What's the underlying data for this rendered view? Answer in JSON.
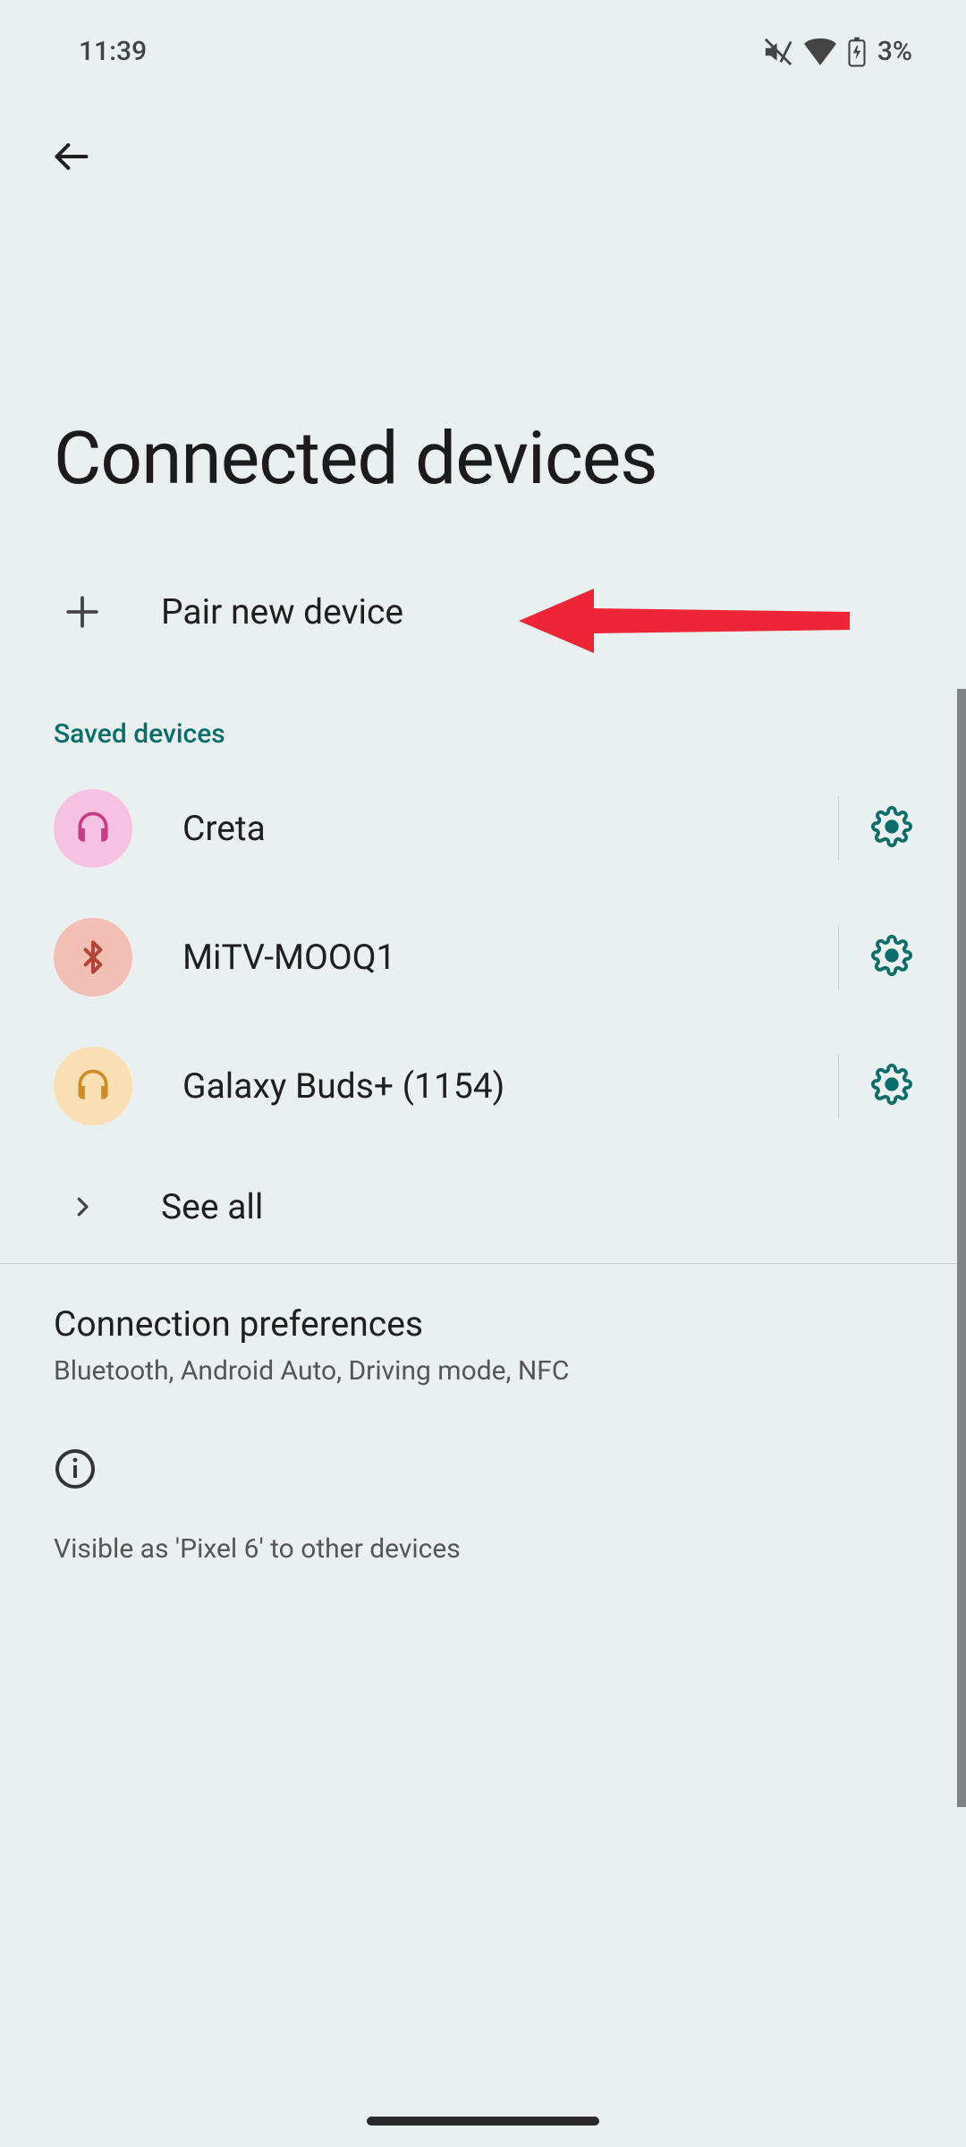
{
  "status": {
    "time": "11:39",
    "battery_pct": "3%"
  },
  "page_title": "Connected devices",
  "pair_new": "Pair new device",
  "section_saved": "Saved devices",
  "devices": [
    {
      "name": "Creta"
    },
    {
      "name": "MiTV-MOOQ1"
    },
    {
      "name": "Galaxy Buds+ (1154)"
    }
  ],
  "see_all": "See all",
  "connection_prefs": {
    "title": "Connection preferences",
    "subtitle": "Bluetooth, Android Auto, Driving mode, NFC"
  },
  "visibility_text": "Visible as 'Pixel 6' to other devices"
}
